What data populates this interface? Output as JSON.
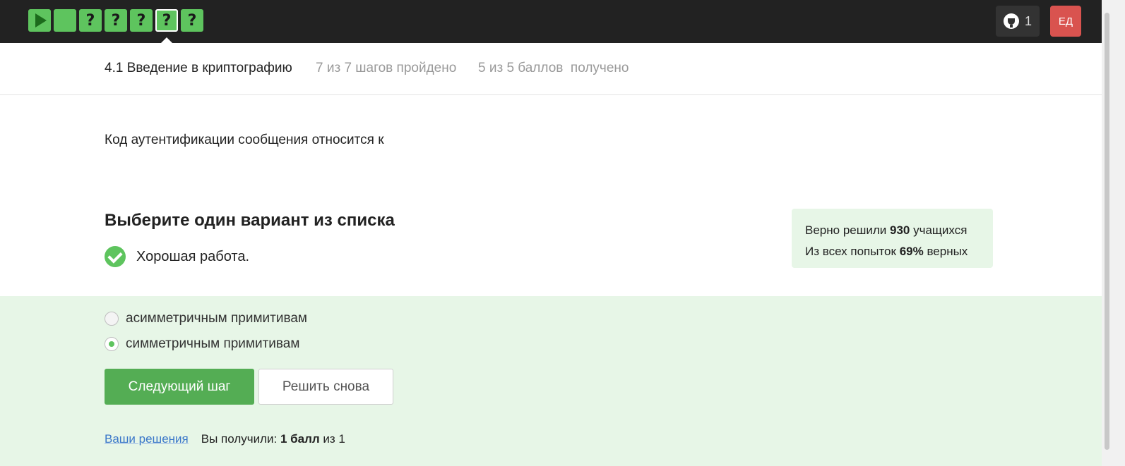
{
  "topbar": {
    "steps": [
      {
        "kind": "video",
        "state": "passed"
      },
      {
        "kind": "text",
        "state": "passed"
      },
      {
        "kind": "quiz",
        "symbol": "?",
        "state": "passed"
      },
      {
        "kind": "quiz",
        "symbol": "?",
        "state": "passed"
      },
      {
        "kind": "quiz",
        "symbol": "?",
        "state": "passed"
      },
      {
        "kind": "quiz",
        "symbol": "?",
        "state": "passed",
        "active": true
      },
      {
        "kind": "quiz",
        "symbol": "?",
        "state": "passed"
      }
    ],
    "trophy_count": "1",
    "avatar_initials": "ЕД"
  },
  "lesson": {
    "title": "4.1 Введение в криптографию",
    "progress": "7 из 7 шагов пройдено",
    "score": "5 из 5 баллов  получено"
  },
  "question": {
    "text": "Код аутентификации сообщения относится к"
  },
  "quiz": {
    "instruction": "Выберите один вариант из списка",
    "feedback": "Хорошая работа.",
    "stats": {
      "line1_prefix": "Верно решили ",
      "line1_value": "930",
      "line1_suffix": " учащихся",
      "line2_prefix": "Из всех попыток ",
      "line2_value": "69%",
      "line2_suffix": " верных"
    },
    "options": [
      {
        "label": "асимметричным примитивам",
        "selected": false
      },
      {
        "label": "симметричным примитивам",
        "selected": true
      }
    ],
    "next_button": "Следующий шаг",
    "retry_button": "Решить снова",
    "solutions_link": "Ваши решения",
    "result_prefix": "Вы получили: ",
    "result_value": "1 балл",
    "result_suffix": " из 1"
  },
  "colors": {
    "topbar_bg": "#222222",
    "step_green": "#5ec45e",
    "button_green": "#54ad54",
    "success_bg": "#e7f6e7",
    "avatar_red": "#d9534f",
    "link_blue": "#3a77c9"
  }
}
